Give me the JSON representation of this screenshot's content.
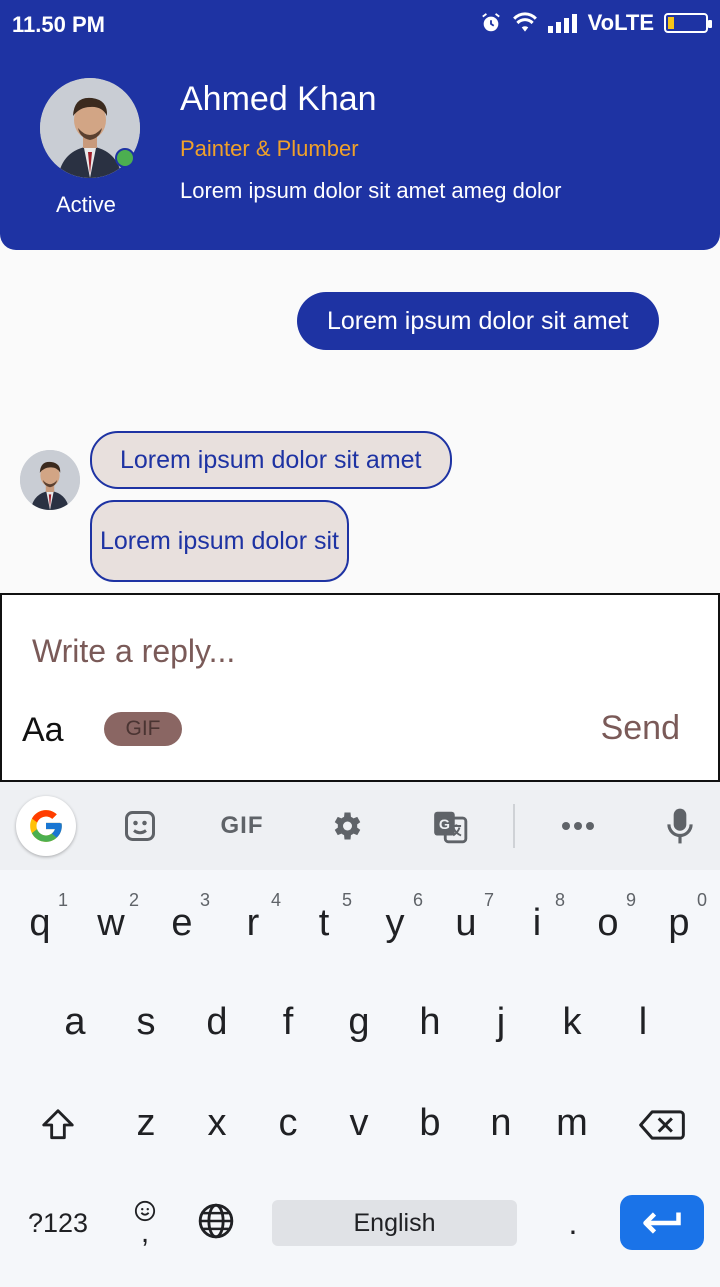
{
  "status_bar": {
    "time": "11.50 PM",
    "network": "VoLTE"
  },
  "profile": {
    "name": "Ahmed Khan",
    "role": "Painter & Plumber",
    "description": "Lorem ipsum dolor sit amet ameg dolor",
    "status": "Active"
  },
  "messages": {
    "outgoing": [
      "Lorem ipsum dolor sit amet"
    ],
    "incoming": [
      "Lorem ipsum dolor sit amet",
      "Lorem ipsum dolor sit"
    ]
  },
  "composer": {
    "placeholder": "Write a reply...",
    "font_toggle": "Aa",
    "gif_label": "GIF",
    "send_label": "Send"
  },
  "keyboard": {
    "toolbar_gif": "GIF",
    "row1": [
      "q",
      "w",
      "e",
      "r",
      "t",
      "y",
      "u",
      "i",
      "o",
      "p"
    ],
    "row1_hints": [
      "1",
      "2",
      "3",
      "4",
      "5",
      "6",
      "7",
      "8",
      "9",
      "0"
    ],
    "row2": [
      "a",
      "s",
      "d",
      "f",
      "g",
      "h",
      "j",
      "k",
      "l"
    ],
    "row3": [
      "z",
      "x",
      "c",
      "v",
      "b",
      "n",
      "m"
    ],
    "symbols_key": "?123",
    "comma_key": ",",
    "space_label": "English",
    "period_key": "."
  },
  "colors": {
    "primary": "#1e33a3",
    "accent": "#f0a12a",
    "online": "#4caf50",
    "send": "#7a5a58",
    "enter": "#1a73e8"
  }
}
